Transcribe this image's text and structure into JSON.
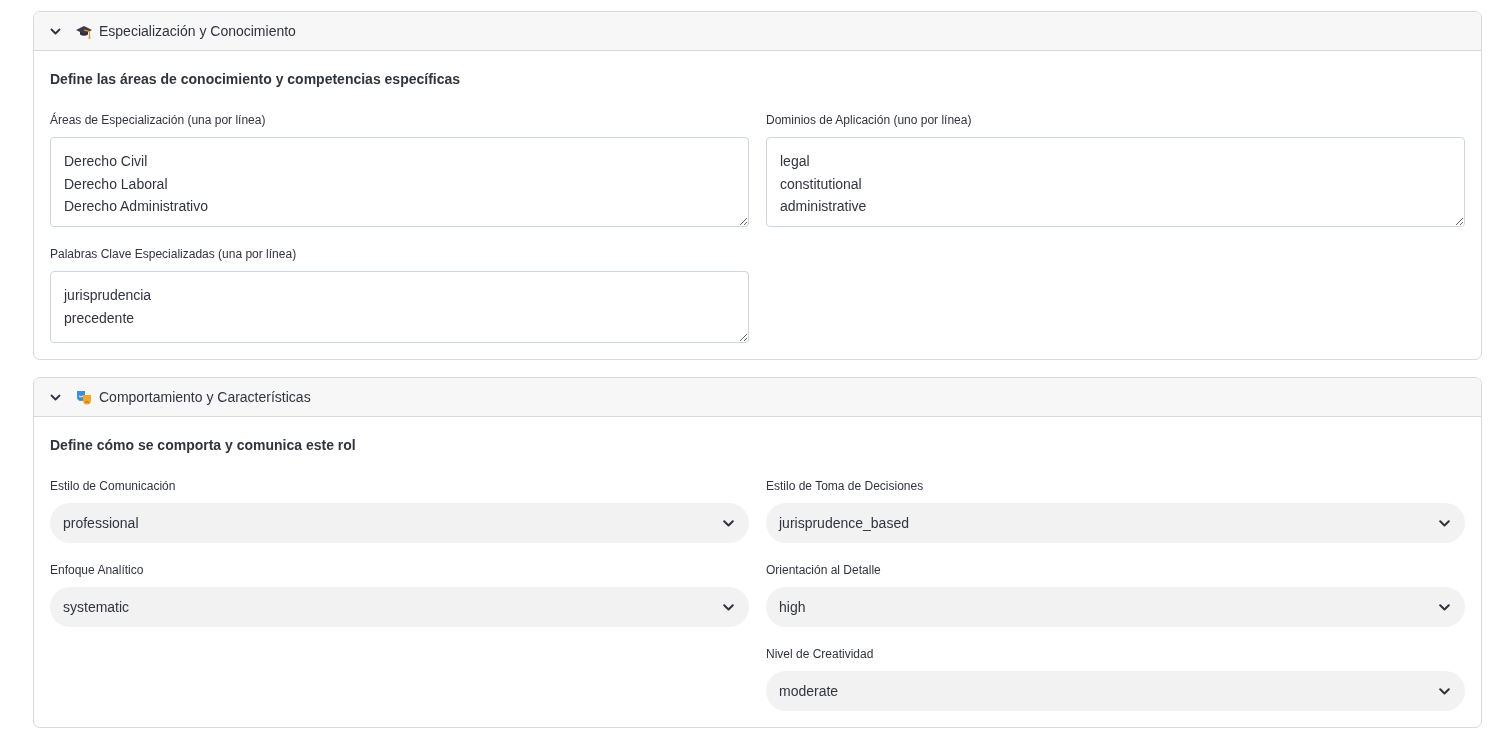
{
  "sections": [
    {
      "title": "Especialización y Conocimiento",
      "expanded": true,
      "subtitle": "Define las áreas de conocimiento y competencias específicas",
      "columns": [
        {
          "fields": [
            {
              "kind": "textarea",
              "label": "Áreas de Especialización (una por línea)",
              "lines": [
                "Derecho Civil",
                "Derecho Laboral",
                "Derecho Administrativo"
              ]
            },
            {
              "kind": "textarea",
              "label": "Palabras Clave Especializadas (una por línea)",
              "lines": [
                "jurisprudencia",
                "precedente"
              ]
            }
          ]
        },
        {
          "fields": [
            {
              "kind": "textarea",
              "label": "Dominios de Aplicación (uno por línea)",
              "lines": [
                "legal",
                "constitutional",
                "administrative"
              ]
            }
          ]
        }
      ]
    },
    {
      "title": "Comportamiento y Características",
      "expanded": true,
      "subtitle": "Define cómo se comporta y comunica este rol",
      "columns": [
        {
          "fields": [
            {
              "kind": "select",
              "label": "Estilo de Comunicación",
              "value": "professional"
            },
            {
              "kind": "select",
              "label": "Enfoque Analítico",
              "value": "systematic"
            }
          ]
        },
        {
          "fields": [
            {
              "kind": "select",
              "label": "Estilo de Toma de Decisiones",
              "value": "jurisprudence_based"
            },
            {
              "kind": "select",
              "label": "Orientación al Detalle",
              "value": "high"
            },
            {
              "kind": "select",
              "label": "Nivel de Creatividad",
              "value": "moderate"
            }
          ]
        }
      ]
    }
  ]
}
